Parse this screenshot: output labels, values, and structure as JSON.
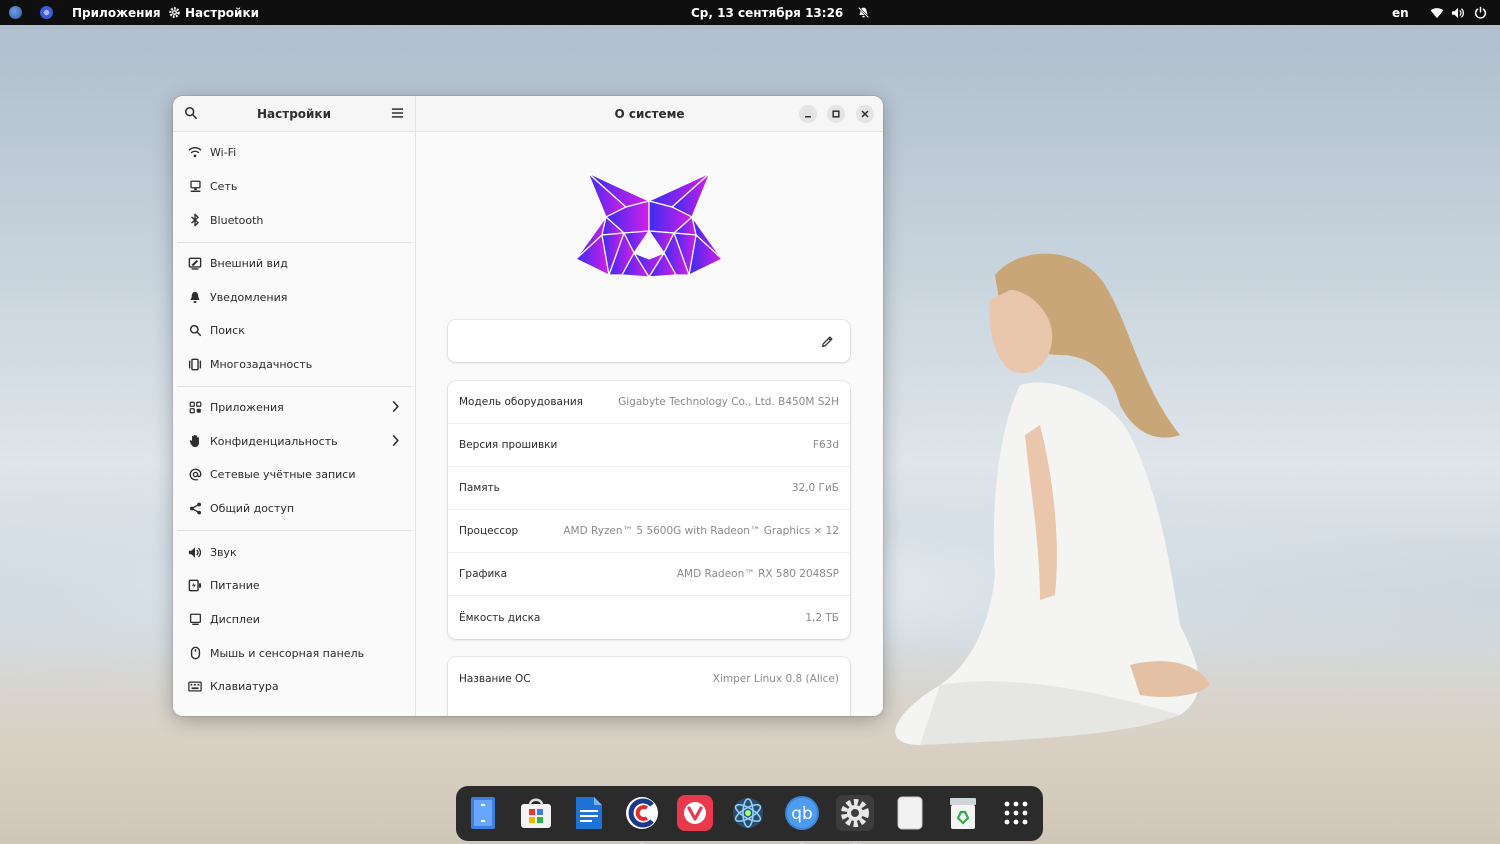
{
  "topbar": {
    "apps_label": "Приложения",
    "settings_label": "Настройки",
    "datetime": "Ср, 13 сентября  13:26",
    "lang": "en"
  },
  "sidebar": {
    "title": "Настройки",
    "items": [
      {
        "label": "Wi-Fi",
        "icon": "wifi-icon"
      },
      {
        "label": "Сеть",
        "icon": "network-icon"
      },
      {
        "label": "Bluetooth",
        "icon": "bluetooth-icon"
      },
      {
        "label": "Внешний вид",
        "icon": "appearance-icon"
      },
      {
        "label": "Уведомления",
        "icon": "bell-icon"
      },
      {
        "label": "Поиск",
        "icon": "search-icon"
      },
      {
        "label": "Многозадачность",
        "icon": "multitasking-icon"
      },
      {
        "label": "Приложения",
        "icon": "apps-grid-icon"
      },
      {
        "label": "Конфиденциальность",
        "icon": "hand-icon"
      },
      {
        "label": "Сетевые учётные записи",
        "icon": "at-icon"
      },
      {
        "label": "Общий доступ",
        "icon": "share-icon"
      },
      {
        "label": "Звук",
        "icon": "speaker-icon"
      },
      {
        "label": "Питание",
        "icon": "power-icon"
      },
      {
        "label": "Дисплеи",
        "icon": "display-icon"
      },
      {
        "label": "Мышь и сенсорная панель",
        "icon": "mouse-icon"
      },
      {
        "label": "Клавиатура",
        "icon": "keyboard-icon"
      }
    ]
  },
  "main": {
    "title": "О системе",
    "device_name": "",
    "hardware": [
      {
        "key": "Модель оборудования",
        "value": "Gigabyte Technology Co., Ltd. B450M S2H"
      },
      {
        "key": "Версия прошивки",
        "value": "F63d"
      },
      {
        "key": "Память",
        "value": "32,0 ГиБ"
      },
      {
        "key": "Процессор",
        "value": "AMD Ryzen™ 5 5600G with Radeon™ Graphics × 12"
      },
      {
        "key": "Графика",
        "value": "AMD Radeon™ RX 580 2048SP"
      },
      {
        "key": "Ёмкость диска",
        "value": "1,2 ТБ"
      }
    ],
    "os": [
      {
        "key": "Название ОС",
        "value": "Ximper Linux 0.8 (Alice)"
      }
    ]
  },
  "dock": {
    "apps": [
      "files-icon",
      "software-store-icon",
      "text-editor-icon",
      "ccleaner-icon",
      "vivaldi-icon",
      "atom-icon",
      "qbittorrent-icon",
      "settings-icon",
      "disk-icon",
      "trash-icon",
      "app-grid-icon"
    ]
  },
  "colors": {
    "topbar": "#0f0f0f",
    "logo_start": "#3a2cf0",
    "logo_end": "#d61ee8",
    "dock": "#2b2b2b"
  }
}
